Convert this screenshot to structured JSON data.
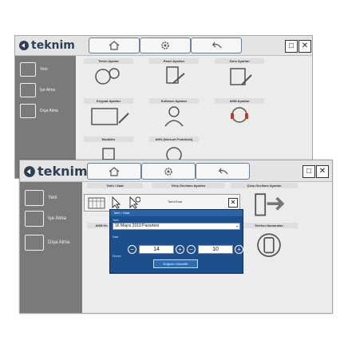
{
  "brand": {
    "name": "teknim"
  },
  "window1": {
    "sidebar": [
      {
        "label": "Yeni",
        "icon": "edit-icon"
      },
      {
        "label": "İşe Alma",
        "icon": "checkmark-icon"
      },
      {
        "label": "Dışa Alma",
        "icon": "export-icon"
      }
    ],
    "tiles": [
      {
        "label": "Temel Ayarlar",
        "icon": "gears-icon"
      },
      {
        "label": "Panel Ayarları",
        "icon": "panel-tools-icon"
      },
      {
        "label": "Zone Ayarları",
        "icon": "building-icon"
      },
      {
        "label": "Keypad Ayarları",
        "icon": "keypad-icon"
      },
      {
        "label": "Kullanıcı Ayarları",
        "icon": "user-icon"
      },
      {
        "label": "AHM Ayarları",
        "icon": "headset-icon"
      },
      {
        "label": "Modüller",
        "icon": "module-icon"
      },
      {
        "label": "AHN (İnternet Protokolü)",
        "icon": "network-icon"
      }
    ]
  },
  "window2": {
    "sidebar": [
      {
        "label": "Yeni",
        "icon": "edit-icon"
      },
      {
        "label": "İşe Alma",
        "icon": "checkmark-icon"
      },
      {
        "label": "Dışa Alma",
        "icon": "export-icon"
      }
    ],
    "tiles": [
      {
        "label": "Tarih / Saat",
        "icon": "calendar-icon"
      },
      {
        "label": "Giriş Gecikme Ayarları",
        "icon": "enter-icon"
      },
      {
        "label": "Çıkış Gecikme Ayarları",
        "icon": "exit-icon"
      },
      {
        "label": "AHM He",
        "icon": "user-icon"
      },
      {
        "label": "Telefon Numaraları",
        "icon": "phone-icon"
      }
    ]
  },
  "dialog": {
    "toolbar_title": "Tarih/Saat",
    "title": "Tarih / Saat",
    "date_label": "Tarih",
    "date_value": "16  Mayıs  2019  Pazartesi",
    "time_label": "Saat",
    "hour": "14",
    "minute": "10",
    "status_label": "Durum",
    "update_button": "Doğrulu Güncelle"
  },
  "colors": {
    "brand": "#2c3e57",
    "sidebar": "#7a7a7a",
    "dialog": "#1d4f8e"
  }
}
